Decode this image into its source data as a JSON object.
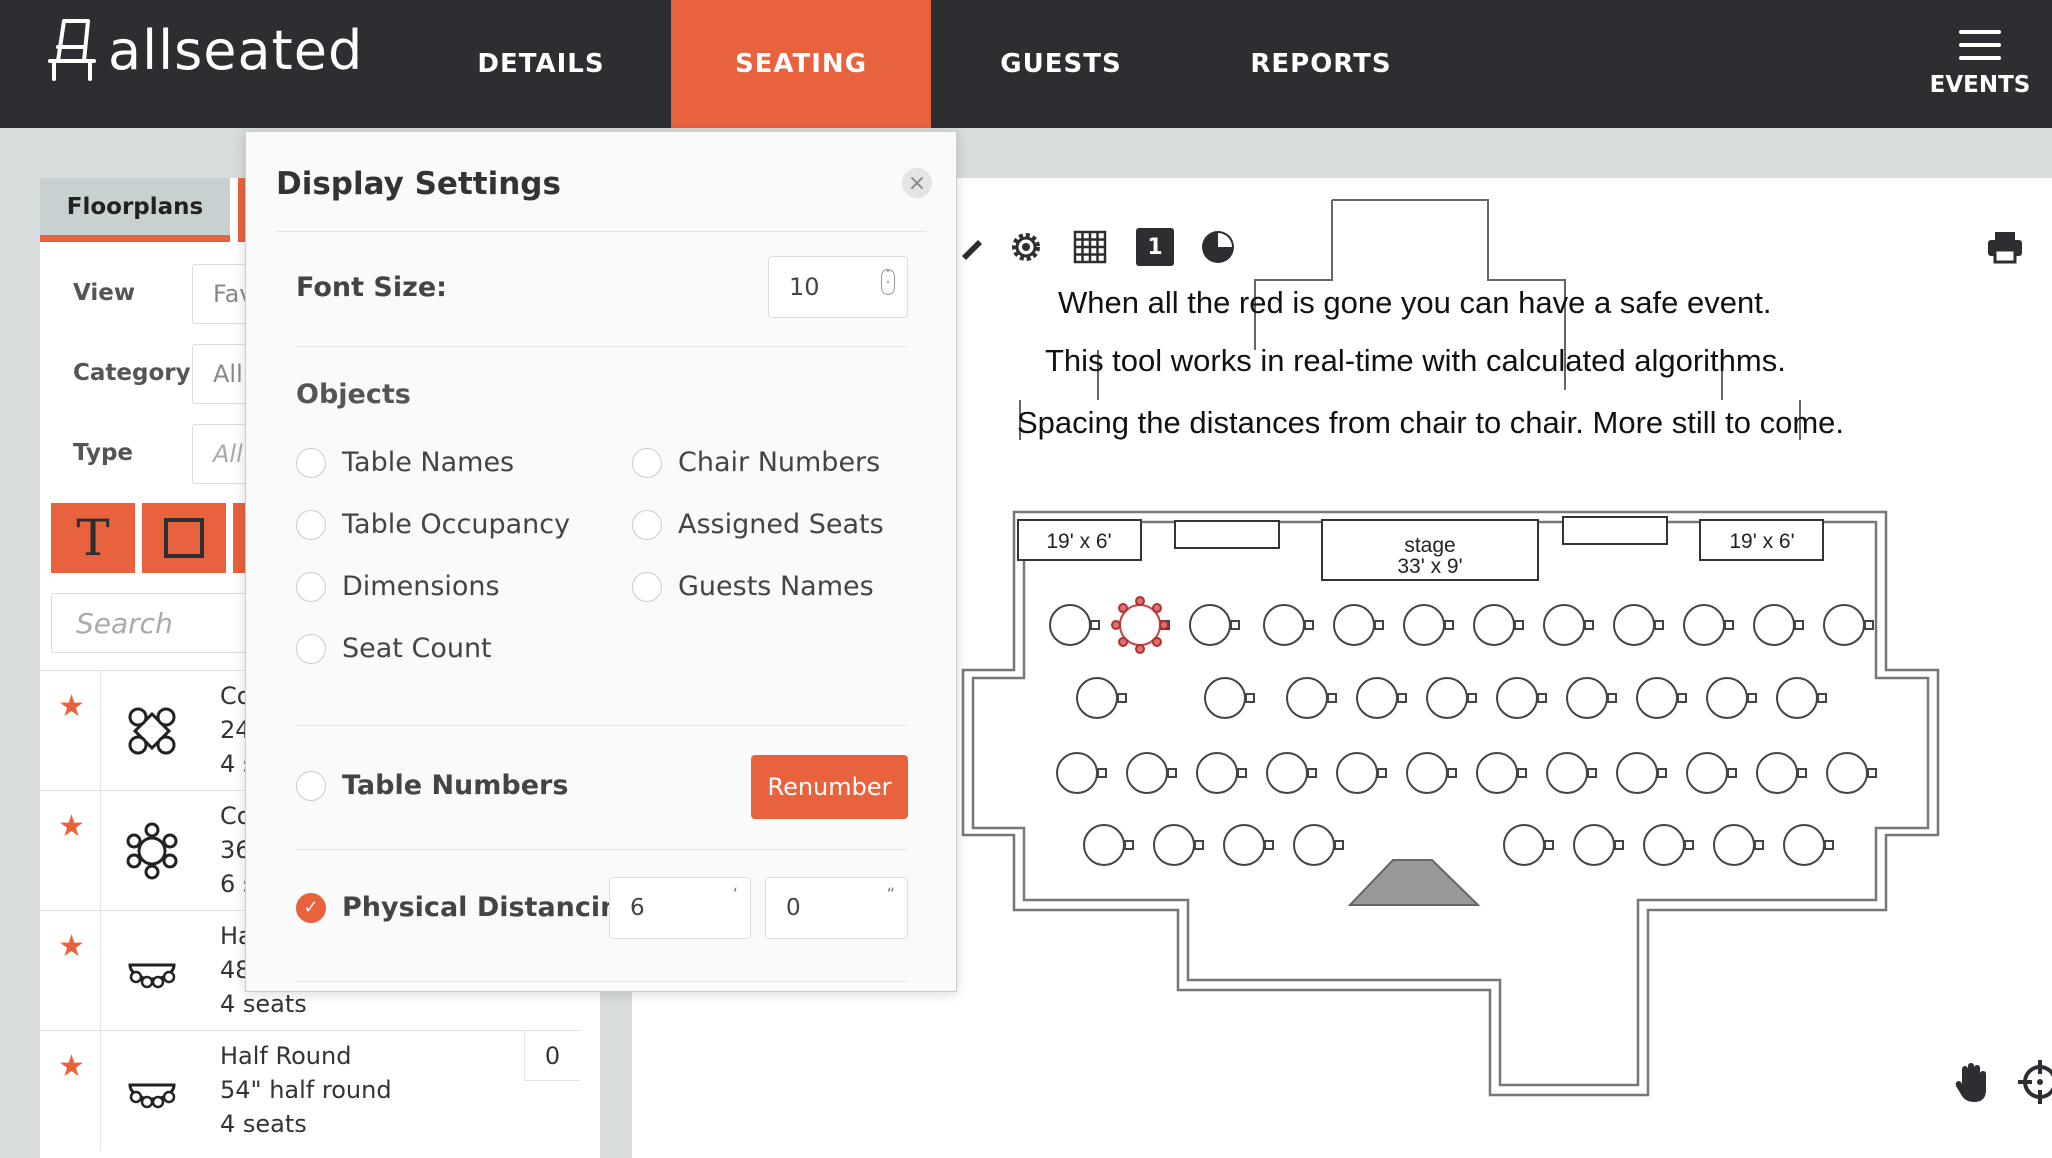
{
  "app": {
    "logo_text": "allseated"
  },
  "nav": {
    "details": "DETAILS",
    "seating": "SEATING",
    "guests": "GUESTS",
    "reports": "REPORTS",
    "events": "EVENTS",
    "active_color": "#e8623d",
    "bar_color": "#2c2e31"
  },
  "left_panel": {
    "tab_label": "Floorplans",
    "view_label": "View",
    "view_value": "Fav",
    "category_label": "Category",
    "category_value": "All",
    "type_label": "Type",
    "type_value": "All",
    "text_tool_glyph": "T",
    "search_placeholder": "Search",
    "items": [
      {
        "line1": "Co",
        "line2": "24",
        "line3": "4 s",
        "icon": "four-chair-table-icon"
      },
      {
        "line1": "Co",
        "line2": "36",
        "line3": "6 s",
        "icon": "round-table-icon"
      },
      {
        "line1": "Ha",
        "line2": "48",
        "line3": "4 seats",
        "icon": "half-round-table-icon"
      },
      {
        "line1": "Half Round",
        "line2": "54\" half round",
        "line3": "4 seats",
        "count": "0",
        "icon": "half-round-table-icon"
      }
    ]
  },
  "display_settings": {
    "title": "Display Settings",
    "font_size_label": "Font Size:",
    "font_size_value": "10",
    "objects_label": "Objects",
    "options": {
      "table_names": "Table Names",
      "chair_numbers": "Chair Numbers",
      "table_occupancy": "Table Occupancy",
      "assigned_seats": "Assigned Seats",
      "dimensions": "Dimensions",
      "guests_names": "Guests Names",
      "seat_count": "Seat Count"
    },
    "table_numbers_label": "Table Numbers",
    "renumber_label": "Renumber",
    "physical_distancing_label": "Physical Distancing",
    "physical_distancing_checked": true,
    "feet_value": "6",
    "feet_unit": "‘",
    "inches_value": "0",
    "inches_unit": "“"
  },
  "canvas": {
    "toolbar_page_number": "1",
    "notes": [
      "When all the red is gone you can have a safe event.",
      "This tool works in real-time with calculated algorithms.",
      "Spacing the distances from chair to chair. More still to come."
    ],
    "floorplan_labels": {
      "left_riser": "19' x 6'",
      "right_riser": "19' x 6'",
      "stage_line1": "stage",
      "stage_line2": "33' x 9'"
    }
  }
}
